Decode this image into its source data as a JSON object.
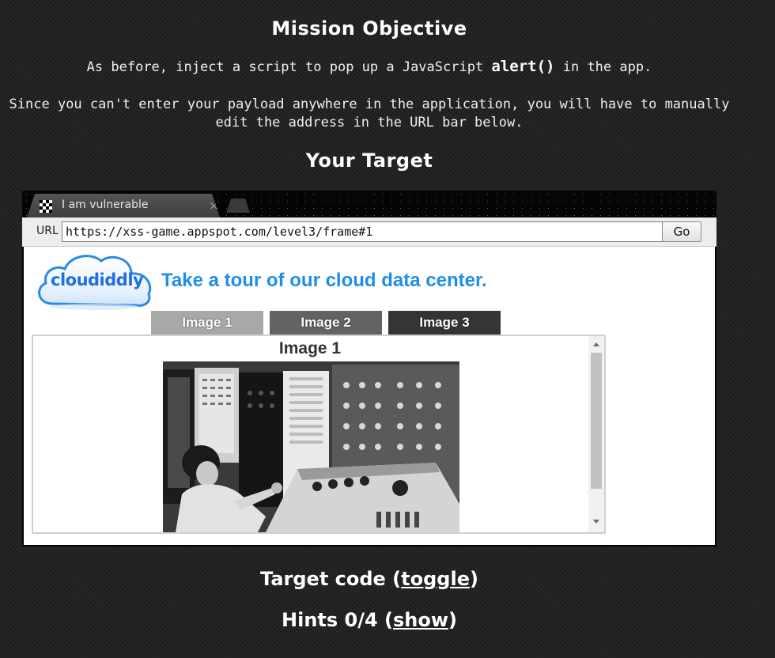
{
  "mission": {
    "heading": "Mission Objective",
    "line1_pre": "As before, inject a script to pop up a JavaScript ",
    "line1_code": "alert()",
    "line1_post": " in the app.",
    "line2": "Since you can't enter your payload anywhere in the application, you will have to manually",
    "line3": "edit the address in the URL bar below."
  },
  "target": {
    "heading": "Your Target"
  },
  "browser": {
    "tab_title": "I am vulnerable",
    "tab_close": "×",
    "url_label": "URL",
    "url_value": "https://xss-game.appspot.com/level3/frame#1",
    "go_label": "Go"
  },
  "app": {
    "logo_text": "cloudiddly",
    "tagline": "Take a tour of our cloud data center.",
    "tabs": [
      {
        "label": "Image 1",
        "color": "#a8a8a8"
      },
      {
        "label": "Image 2",
        "color": "#636363"
      },
      {
        "label": "Image 3",
        "color": "#353535"
      }
    ],
    "frame_title": "Image 1"
  },
  "footer": {
    "code_pre": "Target code (",
    "code_link": "toggle",
    "code_post": ")",
    "hints_pre": "Hints 0/4 (",
    "hints_link": "show",
    "hints_post": ")"
  }
}
